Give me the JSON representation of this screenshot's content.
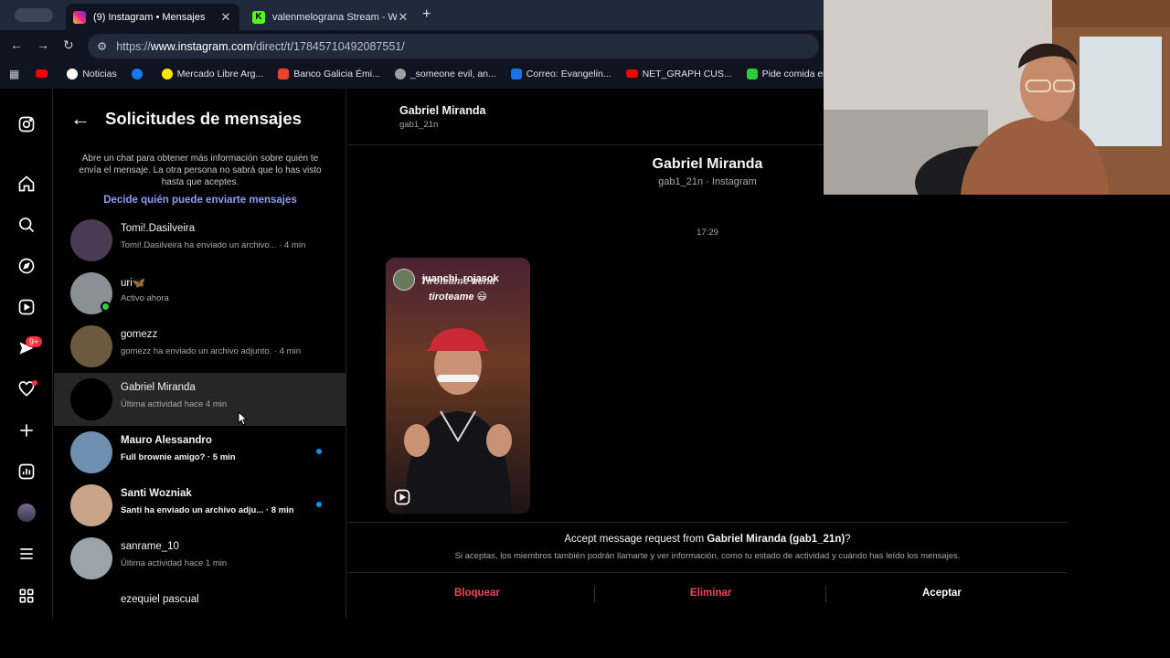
{
  "browser": {
    "tabs": [
      {
        "title": "(9) Instagram • Mensajes",
        "active": true
      },
      {
        "title": "valenmelograna Stream - Wat",
        "active": false
      }
    ],
    "url_prefix": "https://",
    "url_domain": "www.instagram.com",
    "url_path": "/direct/t/17845710492087551/",
    "bookmarks": [
      {
        "label": "",
        "icon": "youtube-icon",
        "color": "#ff0000"
      },
      {
        "label": "Noticias",
        "icon": "google-icon",
        "color": "#ffffff"
      },
      {
        "label": "",
        "icon": "facebook-icon",
        "color": "#1877f2"
      },
      {
        "label": "Mercado Libre Arg...",
        "icon": "mercadolibre-icon",
        "color": "#ffe600"
      },
      {
        "label": "Banco Galicia Émi...",
        "icon": "galicia-icon",
        "color": "#e8442e"
      },
      {
        "label": "_someone evil, an...",
        "icon": "globe-icon",
        "color": "#9aa0a6"
      },
      {
        "label": "Correo: Evangelin...",
        "icon": "outlook-icon",
        "color": "#1a73e8"
      },
      {
        "label": "NET_GRAPH CUS...",
        "icon": "youtube-icon",
        "color": "#ff0000"
      },
      {
        "label": "Pide comida en lín...",
        "icon": "food-icon",
        "color": "#2ccc3b"
      }
    ]
  },
  "rail": {
    "badge": "9+"
  },
  "panel": {
    "title": "Solicitudes de mensajes",
    "info": "Abre un chat para obtener más información sobre quién te envía el mensaje. La otra persona no sabrá que lo has visto hasta que aceptes.",
    "decide_link": "Decide quién puede enviarte mensajes",
    "threads": [
      {
        "name": "Tomi!.Dasilveira",
        "sub": "Tomi!.Dasilveira ha enviado un archivo... · 4 min",
        "avatar": "#4a3a52",
        "unread": false,
        "online": false,
        "selected": false
      },
      {
        "name": "uri🦋",
        "sub": "Activo ahora",
        "avatar": "#8a9096",
        "unread": false,
        "online": true,
        "selected": false
      },
      {
        "name": "gomezz",
        "sub": "gomezz ha enviado un archivo adjunto. · 4 min",
        "avatar": "#6b5a3e",
        "unread": false,
        "online": false,
        "selected": false
      },
      {
        "name": "Gabriel Miranda",
        "sub": "Última actividad hace 4 min",
        "avatar": "#000000",
        "unread": false,
        "online": false,
        "selected": true
      },
      {
        "name": "Mauro Alessandro",
        "sub": "Full brownie amigo? · 5 min",
        "avatar": "#6f8fb0",
        "unread": true,
        "online": false,
        "selected": false
      },
      {
        "name": "Santi Wozniak",
        "sub": "Santi ha enviado un archivo adju... · 8 min",
        "avatar": "#c9a38a",
        "unread": true,
        "online": false,
        "selected": false
      },
      {
        "name": "sanrame_10",
        "sub": "Última actividad hace 1 min",
        "avatar": "#9aa4aa",
        "unread": false,
        "online": false,
        "selected": false
      },
      {
        "name": "ezequiel pascual",
        "sub": "",
        "avatar": "#000000",
        "unread": false,
        "online": false,
        "selected": false
      }
    ]
  },
  "chat": {
    "header_name": "Gabriel Miranda",
    "header_username": "gab1_21n",
    "profile_name": "Gabriel Miranda",
    "profile_sub": "gab1_21n · Instagram",
    "timestamp": "17:29",
    "reel": {
      "username": "juanchi_rojasok",
      "caption": "tiroteame 😃",
      "caption_ghost": "Tiroteame nena"
    },
    "accept_prefix": "Accept message request from ",
    "accept_name": "Gabriel Miranda (gab1_21n)",
    "accept_suffix": "?",
    "accept_sub": "Si aceptas, los miembros también podrán llamarte y ver información, como tu estado de actividad y cuándo has leído los mensajes.",
    "actions": {
      "block": "Bloquear",
      "delete": "Eliminar",
      "accept": "Aceptar"
    }
  },
  "colors": {
    "danger": "#ed4956",
    "link": "#8c9cf5",
    "unread": "#0095f6",
    "online": "#2ccc3b"
  }
}
